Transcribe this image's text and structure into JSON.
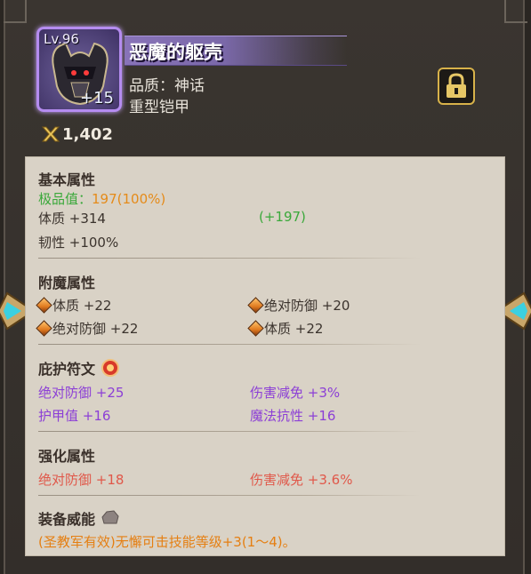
{
  "item": {
    "level": "Lv.96",
    "enhance": "+15",
    "name": "恶魔的躯壳",
    "quality": "品质：神话",
    "type": "重型铠甲",
    "power": "1,402",
    "icon": "demon-helmet-icon"
  },
  "basic": {
    "title": "基本属性",
    "perfect_label": "极品值：",
    "perfect_value": "197(100%)",
    "stat1": "体质 +314",
    "stat1_bonus": "(+197)",
    "stat2": "韧性 +100%"
  },
  "enchant": {
    "title": "附魔属性",
    "items": [
      "体质 +22",
      "绝对防御 +20",
      "绝对防御 +22",
      "体质 +22"
    ]
  },
  "rune": {
    "title": "庇护符文",
    "items": [
      "绝对防御 +25",
      "伤害减免 +3%",
      "护甲值 +16",
      "魔法抗性 +16"
    ]
  },
  "reinforce": {
    "title": "强化属性",
    "items": [
      "绝对防御 +18",
      "伤害减免 +3.6%"
    ]
  },
  "equip_power": {
    "title": "装备威能",
    "text": "(圣教军有效)无懈可击技能等级+3(1～4)。"
  },
  "colors": {
    "perfect_green": "#3aa83a",
    "perfect_orange": "#e58b1a",
    "rune_purple": "#8c3fd6",
    "reinforce_red": "#e0584a",
    "lock_border": "#d8b24a",
    "item_border": "#b58cf0"
  }
}
